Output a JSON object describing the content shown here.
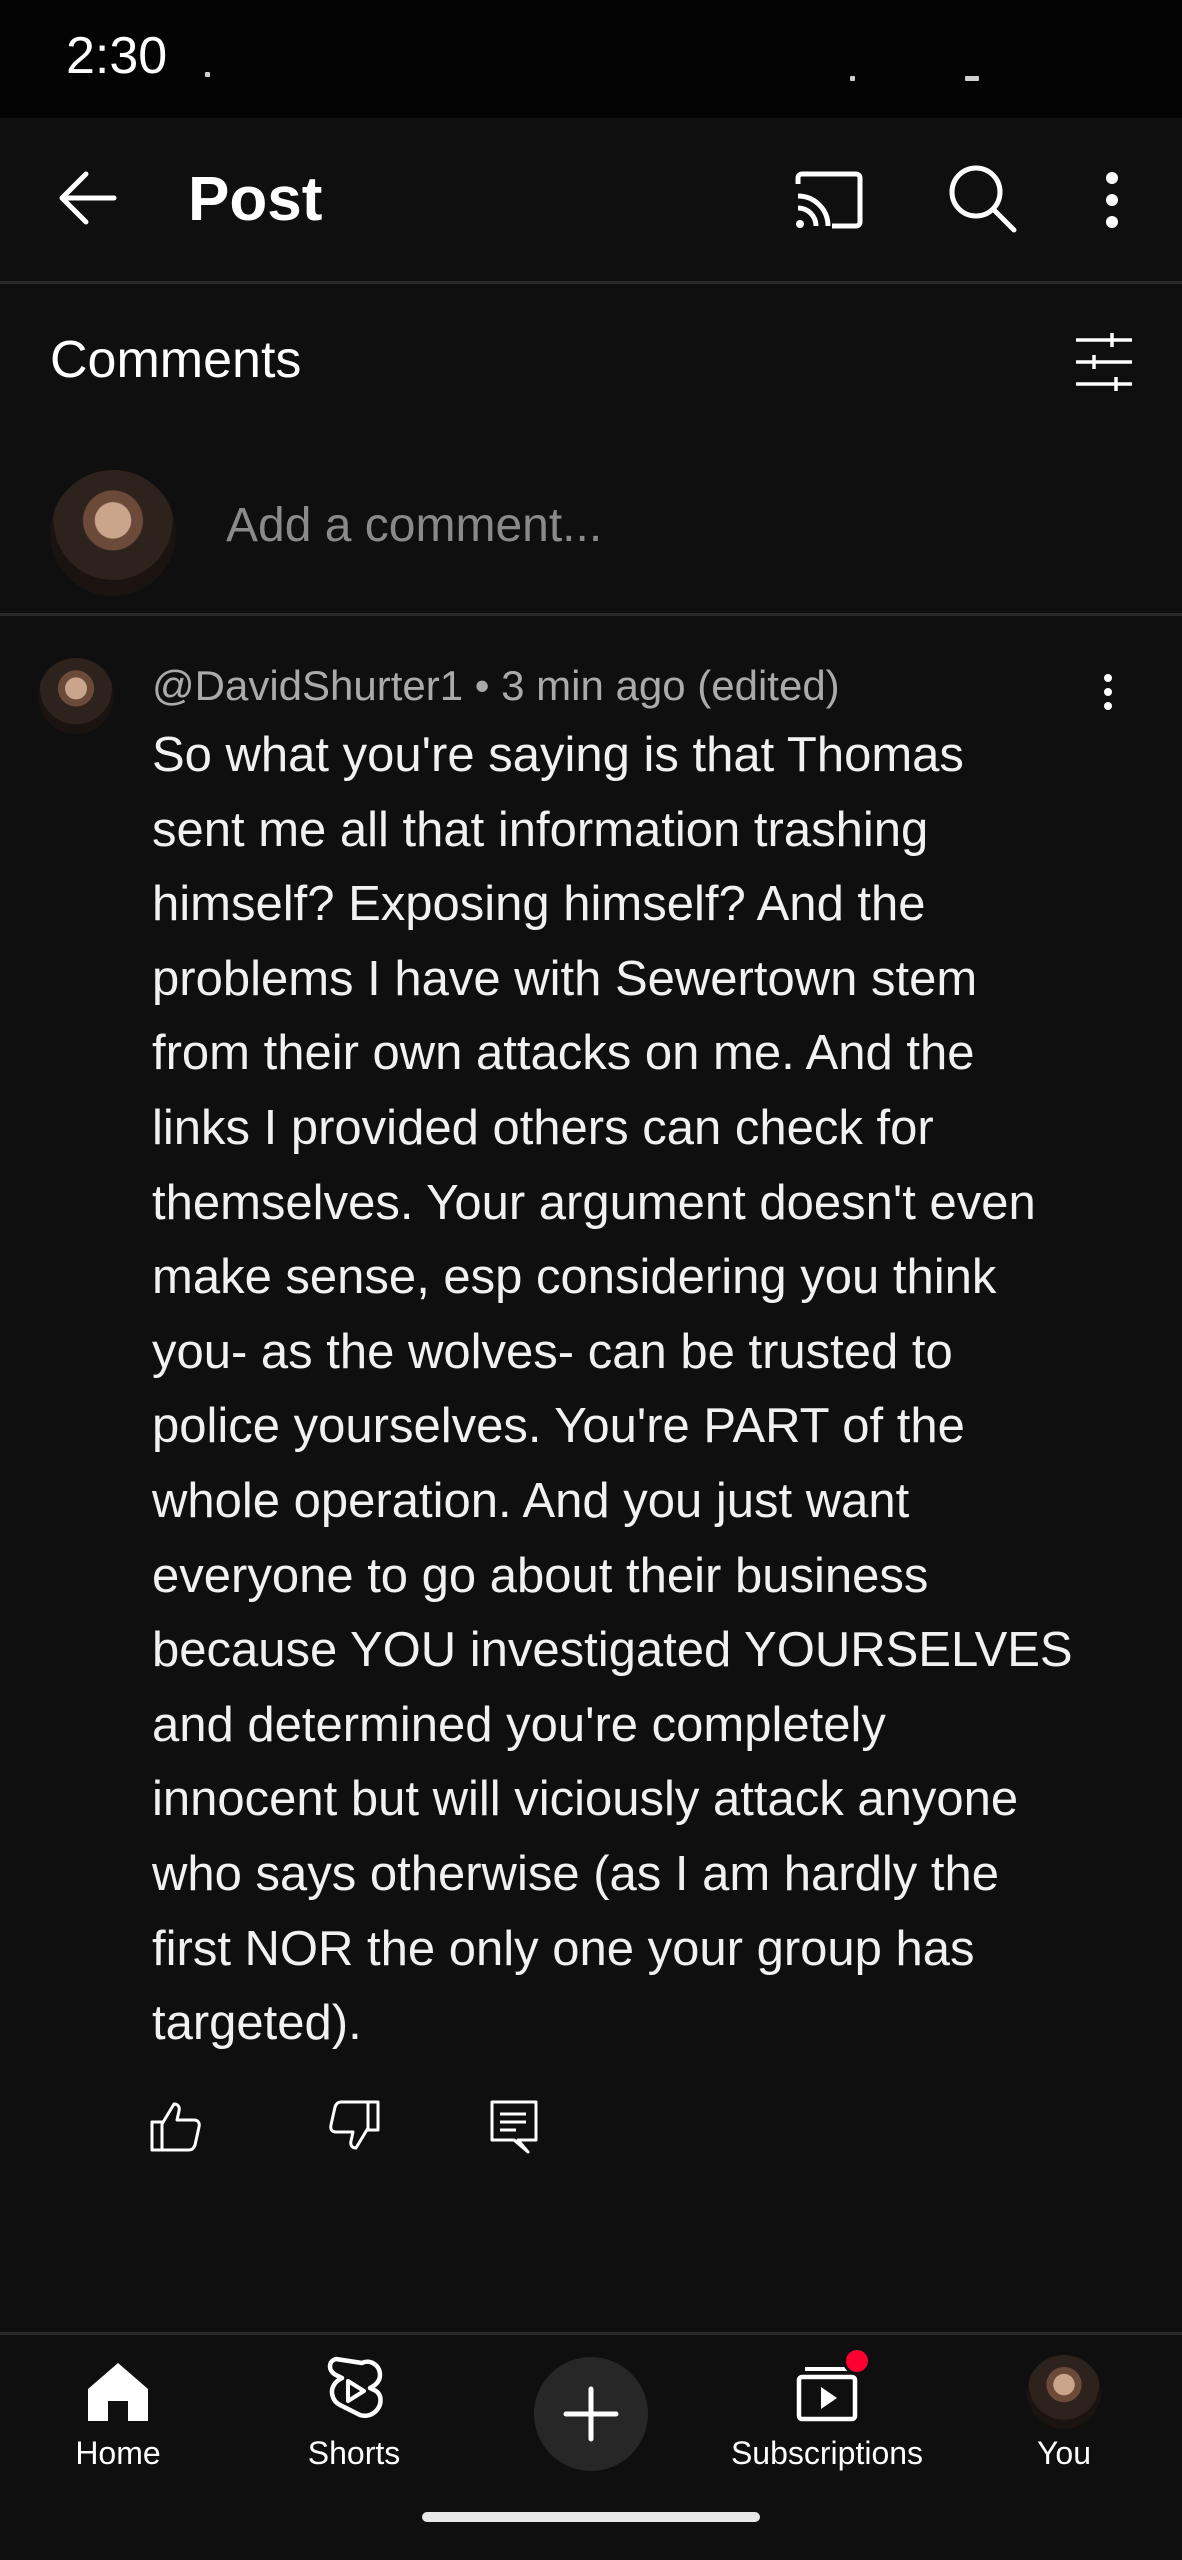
{
  "status_bar": {
    "time": "2:30"
  },
  "header": {
    "title": "Post",
    "icons": [
      "back-arrow-icon",
      "cast-icon",
      "search-icon",
      "more-vert-icon"
    ]
  },
  "comments_section": {
    "heading": "Comments",
    "add_comment_placeholder": "Add a comment..."
  },
  "comment": {
    "meta": "@DavidShurter1 • 3 min ago (edited)",
    "lines": [
      "So what you're saying is that Thomas",
      "sent me all that information trashing",
      "himself? Exposing himself? And the",
      "problems I have with Sewertown stem",
      "from their own attacks on me. And the",
      "links I provided others can check for",
      "themselves. Your argument doesn't even",
      "make sense, esp considering you think",
      "you- as the wolves- can be trusted to",
      "police yourselves. You're PART of the",
      "whole operation. And you just want",
      "everyone to go about their business",
      "because YOU investigated YOURSELVES",
      "and determined you're completely",
      "innocent but will viciously attack anyone",
      "who says otherwise (as I am hardly the",
      "first NOR the only one your group has",
      "targeted)."
    ]
  },
  "bottom_nav": {
    "home": "Home",
    "shorts": "Shorts",
    "subscriptions": "Subscriptions",
    "you": "You"
  },
  "colors": {
    "background": "#0f0f0f",
    "notification_dot": "#ff0033"
  }
}
